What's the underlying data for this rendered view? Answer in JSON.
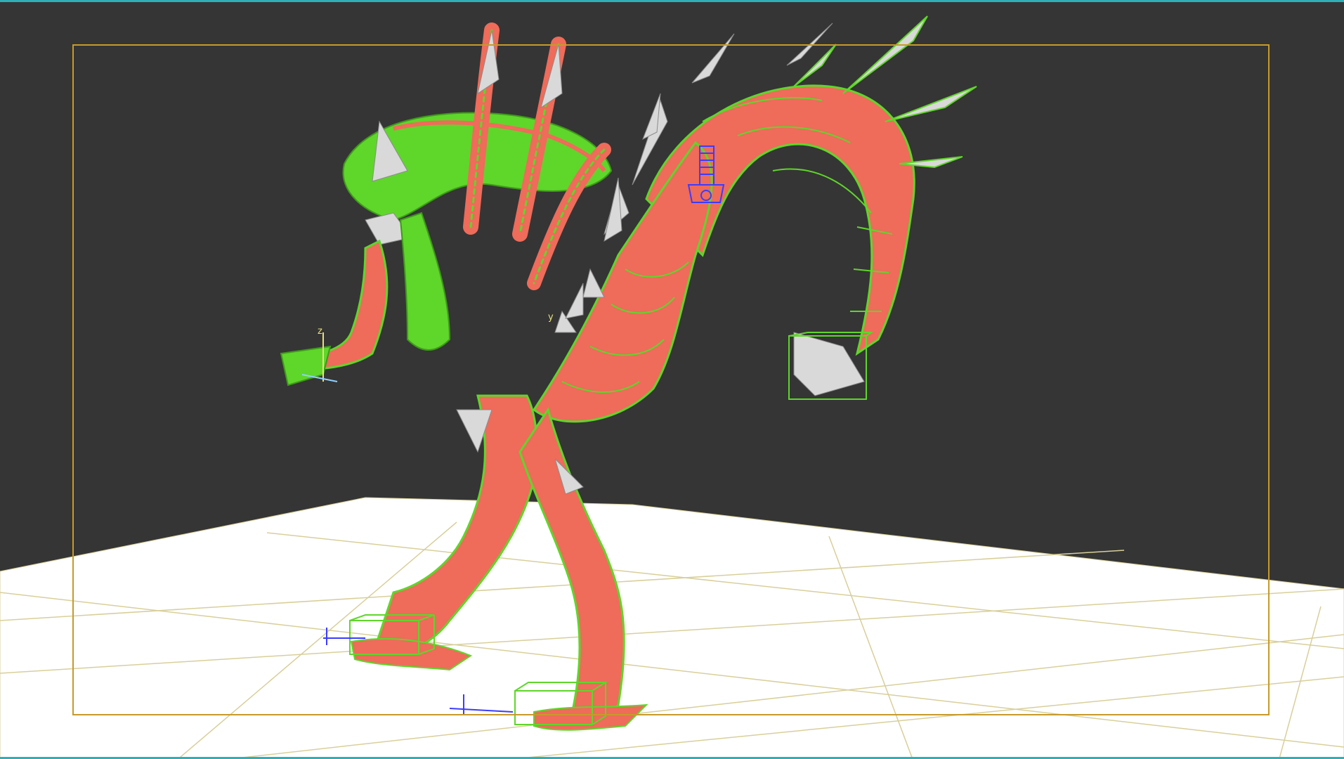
{
  "viewport": {
    "background_color": "#353535",
    "floor_color": "#ffffff",
    "floor_grid_color": "#d8cf9a",
    "safe_frame_color": "#c79a2a",
    "active_border_color": "#2fb0b8",
    "mesh_color": "#ef6b5a",
    "wireframe_color": "#5fd62a",
    "bone_color": "#d9d9d9",
    "control_color": "#3c3cff"
  },
  "gizmo": {
    "z_label": "z",
    "y_label": "y"
  },
  "icons": {
    "biped_root": "biped-root-icon",
    "transform_gizmo": "transform-gizmo-icon",
    "foot_helper": "foot-helper-box-icon"
  }
}
